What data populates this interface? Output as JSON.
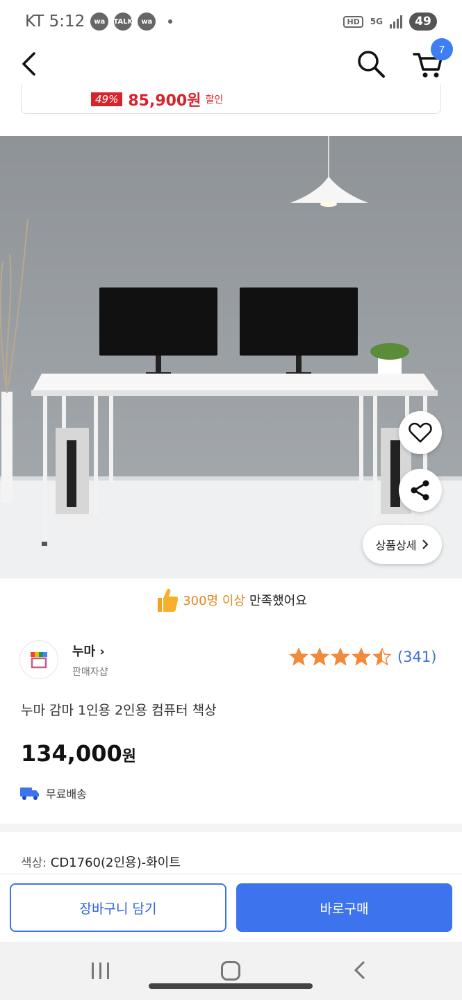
{
  "status_bar": {
    "carrier_time": "KT 5:12",
    "app_icons": [
      "wa",
      "TALK",
      "wa"
    ],
    "hd": "HD",
    "network": "5G",
    "battery": "49"
  },
  "nav": {
    "back_icon": "chevron-left-icon",
    "search_icon": "search-icon",
    "cart_icon": "cart-icon",
    "cart_badge": "7"
  },
  "coupon": {
    "percent": "49%",
    "price": "85,900원",
    "suffix": "할인"
  },
  "photo": {
    "detail_label": "상품상세"
  },
  "satisfaction": {
    "highlight": "300명 이상",
    "rest": "만족했어요"
  },
  "seller": {
    "name": "누마",
    "chevron": "›",
    "subtitle": "판매자샵"
  },
  "rating": {
    "stars": 4.5,
    "count": "(341)"
  },
  "product": {
    "title": "누마 감마 1인용 2인용 컴퓨터 책상",
    "price": "134,000",
    "currency": "원",
    "shipping": "무료배송"
  },
  "option": {
    "label": "색상:",
    "value": "CD1760(2인용)-화이트"
  },
  "actions": {
    "cart_label": "장바구니 담기",
    "buy_label": "바로구매"
  },
  "colors": {
    "accent_blue": "#3d74ee",
    "discount_red": "#d9232c",
    "star_orange": "#f18a3a",
    "satisfaction_orange": "#e08a1e"
  }
}
